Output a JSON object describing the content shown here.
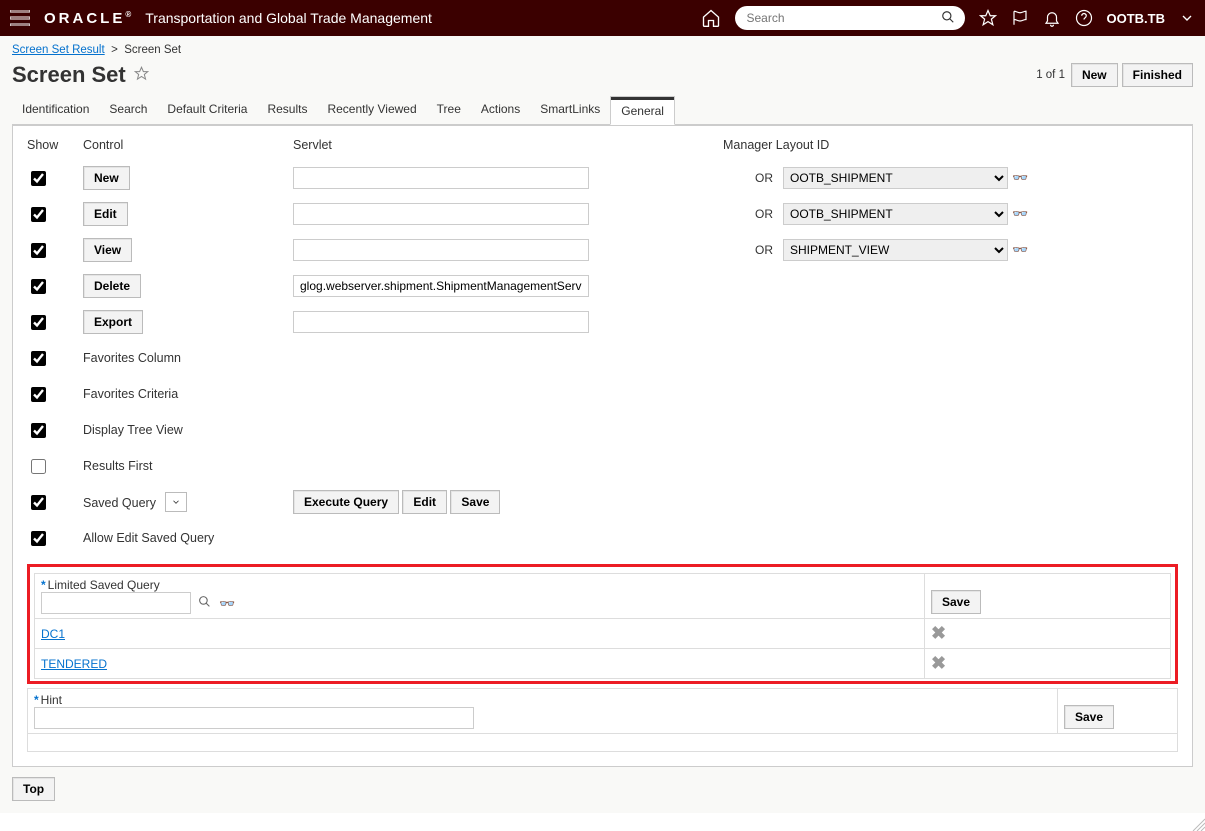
{
  "header": {
    "brand": "ORACLE",
    "app_title": "Transportation and Global Trade Management",
    "search_placeholder": "Search",
    "user": "OOTB.TB"
  },
  "breadcrumb": {
    "link_text": "Screen Set Result",
    "current": "Screen Set"
  },
  "page": {
    "title": "Screen Set",
    "record_count": "1 of 1",
    "new_label": "New",
    "finished_label": "Finished"
  },
  "tabs": [
    "Identification",
    "Search",
    "Default Criteria",
    "Results",
    "Recently Viewed",
    "Tree",
    "Actions",
    "SmartLinks",
    "General"
  ],
  "active_tab": "General",
  "column_headers": {
    "show": "Show",
    "control": "Control",
    "servlet": "Servlet",
    "mgr": "Manager Layout ID"
  },
  "rows": [
    {
      "show": true,
      "control": "New",
      "servlet": "",
      "or": "OR",
      "mgr": "OOTB_SHIPMENT"
    },
    {
      "show": true,
      "control": "Edit",
      "servlet": "",
      "or": "OR",
      "mgr": "OOTB_SHIPMENT"
    },
    {
      "show": true,
      "control": "View",
      "servlet": "",
      "or": "OR",
      "mgr": "SHIPMENT_VIEW"
    },
    {
      "show": true,
      "control": "Delete",
      "servlet": "glog.webserver.shipment.ShipmentManagementServl",
      "or": "",
      "mgr": ""
    },
    {
      "show": true,
      "control": "Export",
      "servlet": "",
      "or": "",
      "mgr": ""
    }
  ],
  "check_rows": [
    {
      "checked": true,
      "label": "Favorites Column"
    },
    {
      "checked": true,
      "label": "Favorites Criteria"
    },
    {
      "checked": true,
      "label": "Display Tree View"
    },
    {
      "checked": false,
      "label": "Results First"
    }
  ],
  "saved_query": {
    "checked": true,
    "label": "Saved Query"
  },
  "allow_edit": {
    "checked": true,
    "label": "Allow Edit Saved Query"
  },
  "query_buttons": {
    "exec": "Execute Query",
    "edit": "Edit",
    "save": "Save"
  },
  "limited_section": {
    "title": "Limited Saved Query",
    "save": "Save",
    "items": [
      "DC1",
      "TENDERED"
    ]
  },
  "hint_section": {
    "title": "Hint",
    "save": "Save"
  },
  "footer": {
    "top": "Top"
  },
  "or_label": "OR"
}
